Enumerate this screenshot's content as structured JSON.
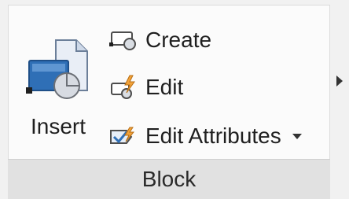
{
  "panel": {
    "insert": {
      "label": "Insert",
      "icon": "insert-block-icon"
    },
    "create": {
      "label": "Create",
      "icon": "create-block-icon"
    },
    "edit": {
      "label": "Edit",
      "icon": "edit-block-icon"
    },
    "edit_attributes": {
      "label": "Edit Attributes",
      "icon": "edit-attributes-icon"
    },
    "title": "Block"
  },
  "colors": {
    "panel_bg": "#fbfbfb",
    "footer_bg": "#e1e1e1",
    "accent_blue": "#2f6fb6",
    "accent_orange": "#f2a23a"
  }
}
